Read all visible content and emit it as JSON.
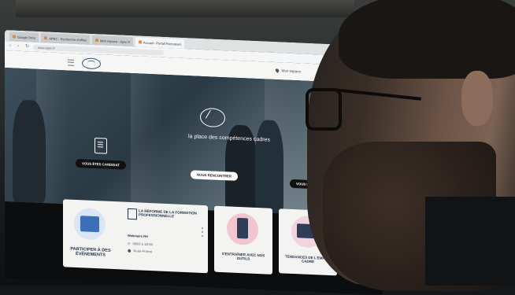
{
  "browser": {
    "tabs": [
      {
        "label": "Google Drive"
      },
      {
        "label": "APEC - Recherche d'offres"
      },
      {
        "label": "Mon espace - Apec.fr"
      },
      {
        "label": "Accueil - Portail Recruteurs"
      }
    ],
    "url": "www.apec.fr"
  },
  "site": {
    "space_link": "Mon espace",
    "tagline": "la place des compétences cadres",
    "cta_candidate": "VOUS ÊTES CANDIDAT",
    "cta_meet": "NOUS RENCONTRER",
    "cta_recruiter": "VOUS ÊTES RECRUTEUR"
  },
  "cards": {
    "events": {
      "title": "PARTICIPER À DES ÉVÉNEMENTS"
    },
    "reform": {
      "title": "LA RÉFORME DE LA FORMATION PROFESSIONNELLE",
      "meta_label": "Webinaire RH",
      "time": "09/03 à 12h00",
      "location": "Île-de-France"
    },
    "tools": {
      "title": "S'ENTRAÎNER AVEC NOS OUTILS"
    },
    "trends": {
      "title": "TENDANCES DE L'EMPLOI CADRE"
    }
  },
  "colors": {
    "accent_blue": "#2c5a8a",
    "card_title": "#23324a",
    "illus_pink": "#d46a8c",
    "illus_blue": "#3d6fb8"
  }
}
